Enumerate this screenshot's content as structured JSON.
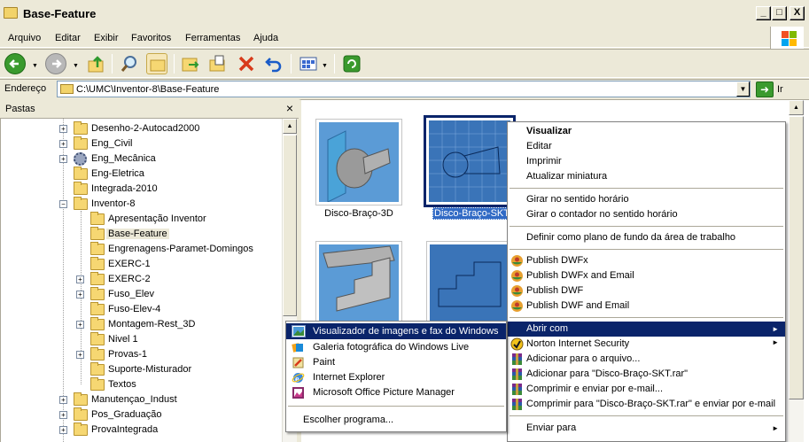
{
  "window": {
    "title": "Base-Feature"
  },
  "titlebar_buttons": {
    "minimize": "_",
    "maximize": "□",
    "close": "X"
  },
  "menu": [
    "Arquivo",
    "Editar",
    "Exibir",
    "Favoritos",
    "Ferramentas",
    "Ajuda"
  ],
  "address": {
    "label": "Endereço",
    "path": "C:\\UMC\\Inventor-8\\Base-Feature",
    "go_label": "Ir"
  },
  "folders_pane": {
    "title": "Pastas",
    "close": "×"
  },
  "tree": [
    {
      "label": "Desenho-2-Autocad2000",
      "expander": "+"
    },
    {
      "label": "Eng_Civil",
      "expander": "+"
    },
    {
      "label": "Eng_Mecânica",
      "expander": "+"
    },
    {
      "label": "Eng-Eletrica",
      "expander": ""
    },
    {
      "label": "Integrada-2010",
      "expander": ""
    },
    {
      "label": "Inventor-8",
      "expander": "−"
    },
    {
      "label": "Apresentação Inventor",
      "expander": ""
    },
    {
      "label": "Base-Feature",
      "expander": ""
    },
    {
      "label": "Engrenagens-Paramet-Domingos",
      "expander": ""
    },
    {
      "label": "EXERC-1",
      "expander": ""
    },
    {
      "label": "EXERC-2",
      "expander": "+"
    },
    {
      "label": "Fuso_Elev",
      "expander": "+"
    },
    {
      "label": "Fuso-Elev-4",
      "expander": ""
    },
    {
      "label": "Montagem-Rest_3D",
      "expander": "+"
    },
    {
      "label": "Nivel 1",
      "expander": ""
    },
    {
      "label": "Provas-1",
      "expander": "+"
    },
    {
      "label": "Suporte-Misturador",
      "expander": ""
    },
    {
      "label": "Textos",
      "expander": ""
    },
    {
      "label": "Manutençao_Indust",
      "expander": "+"
    },
    {
      "label": "Pos_Graduação",
      "expander": "+"
    },
    {
      "label": "ProvaIntegrada",
      "expander": "+"
    }
  ],
  "files": [
    {
      "name": "Disco-Braço-3D",
      "selected": false
    },
    {
      "name": "Disco-Braço-SKT",
      "selected": true
    },
    {
      "name": "",
      "selected": false
    },
    {
      "name": "",
      "selected": false
    }
  ],
  "context_menu": {
    "items": [
      {
        "label": "Visualizar",
        "bold": true
      },
      {
        "label": "Editar"
      },
      {
        "label": "Imprimir"
      },
      {
        "label": "Atualizar miniatura"
      },
      {
        "label": "Girar no sentido horário"
      },
      {
        "label": "Girar o contador no sentido horário"
      },
      {
        "label": "Definir como plano de fundo da área de trabalho"
      },
      {
        "label": "Publish DWFx",
        "icon": "autodesk-icon"
      },
      {
        "label": "Publish DWFx and Email",
        "icon": "autodesk-icon"
      },
      {
        "label": "Publish DWF",
        "icon": "autodesk-icon"
      },
      {
        "label": "Publish DWF and Email",
        "icon": "autodesk-icon"
      },
      {
        "label": "Abrir com",
        "submenu": true,
        "highlighted": true
      },
      {
        "label": "Norton Internet Security",
        "icon": "norton-icon",
        "submenu": true
      },
      {
        "label": "Adicionar para o arquivo...",
        "icon": "winrar-icon"
      },
      {
        "label": "Adicionar para \"Disco-Braço-SKT.rar\"",
        "icon": "winrar-icon"
      },
      {
        "label": "Comprimir e enviar por e-mail...",
        "icon": "winrar-icon"
      },
      {
        "label": "Comprimir para \"Disco-Braço-SKT.rar\" e enviar por e-mail",
        "icon": "winrar-icon"
      },
      {
        "label": "Enviar para",
        "submenu": true
      }
    ]
  },
  "open_with_menu": {
    "items": [
      {
        "label": "Visualizador de imagens e fax do Windows",
        "icon": "image-viewer-icon",
        "highlighted": true
      },
      {
        "label": "Galeria fotográfica do Windows Live",
        "icon": "photo-gallery-icon"
      },
      {
        "label": "Paint",
        "icon": "paint-icon"
      },
      {
        "label": "Internet Explorer",
        "icon": "internet-explorer-icon"
      },
      {
        "label": "Microsoft Office Picture Manager",
        "icon": "picture-manager-icon"
      },
      {
        "label": "Escolher programa..."
      }
    ]
  },
  "colors": {
    "selection": "#0a246a",
    "highlight": "#316ac5",
    "chrome": "#ece9d8"
  }
}
